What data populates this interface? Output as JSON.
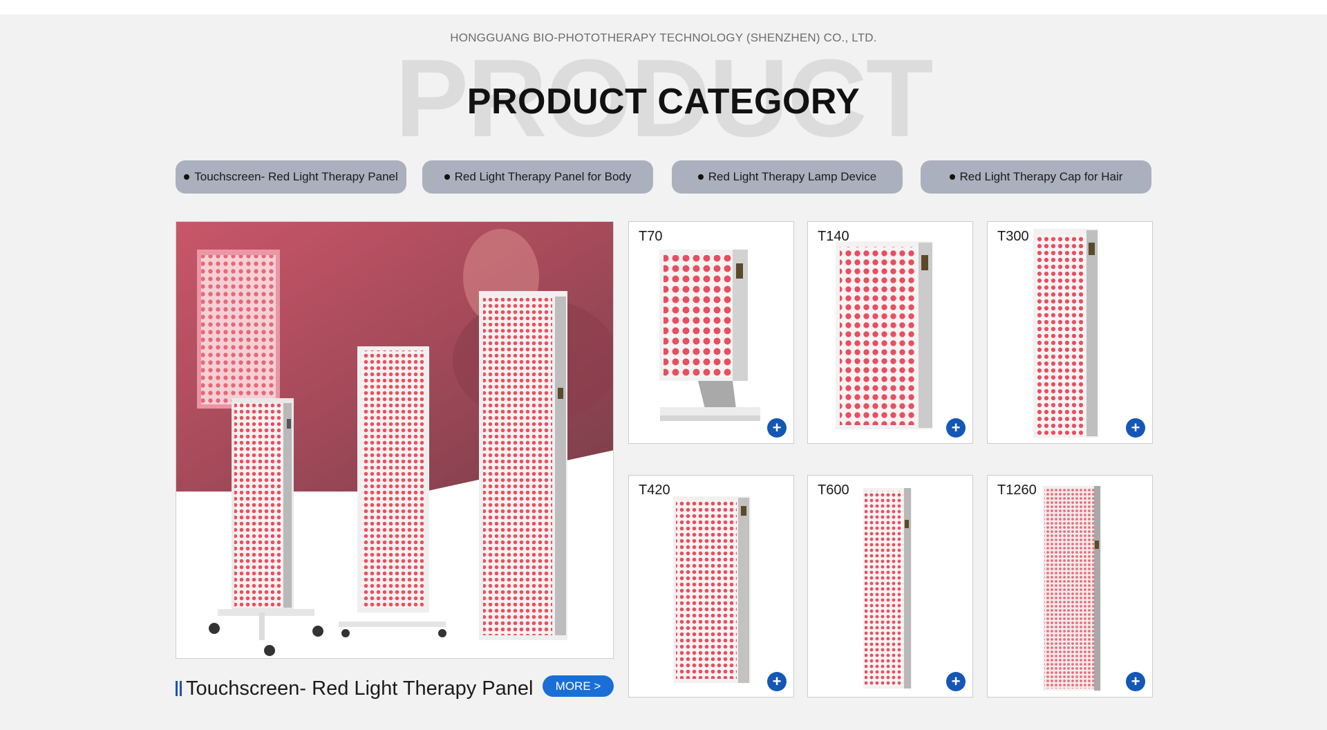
{
  "header": {
    "company": "HONGGUANG BIO-PHOTOTHERAPY TECHNOLOGY (SHENZHEN) CO., LTD.",
    "background_word": "PRODUCT",
    "title": "PRODUCT CATEGORY"
  },
  "tabs": [
    {
      "label": "Touchscreen- Red Light Therapy Panel"
    },
    {
      "label": "Red Light Therapy Panel for Body"
    },
    {
      "label": "Red Light Therapy Lamp Device"
    },
    {
      "label": "Red Light Therapy Cap for Hair"
    }
  ],
  "hero": {
    "caption": "Touchscreen- Red Light Therapy Panel",
    "more_label": "MORE >"
  },
  "products": [
    {
      "label": "T70",
      "icon": "plus-icon"
    },
    {
      "label": "T140",
      "icon": "plus-icon"
    },
    {
      "label": "T300",
      "icon": "plus-icon"
    },
    {
      "label": "T420",
      "icon": "plus-icon"
    },
    {
      "label": "T600",
      "icon": "plus-icon"
    },
    {
      "label": "T1260",
      "icon": "plus-icon"
    }
  ],
  "colors": {
    "background": "#f2f2f2",
    "tab_bg": "#aab0bd",
    "accent_blue": "#1a6fd6",
    "plus_blue": "#1457b7",
    "led_red": "#e8505f"
  }
}
